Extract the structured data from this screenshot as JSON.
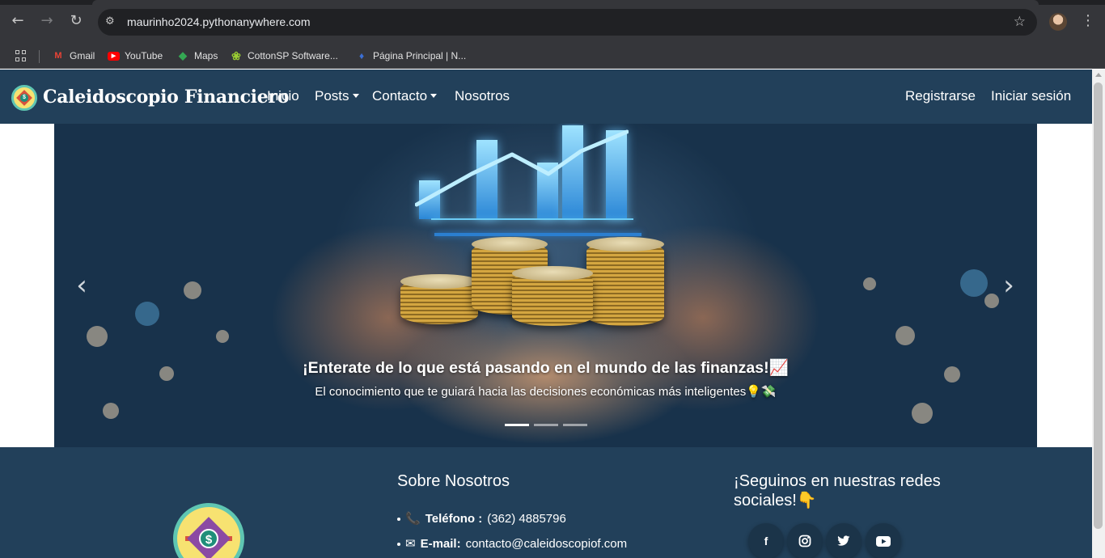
{
  "browser": {
    "url": "maurinho2024.pythonanywhere.com",
    "nav": {
      "back": "←",
      "forward": "→",
      "reload": "↻"
    },
    "bookmarks": [
      {
        "label": "Gmail",
        "icon": "gmail-icon"
      },
      {
        "label": "YouTube",
        "icon": "youtube-icon"
      },
      {
        "label": "Maps",
        "icon": "maps-icon"
      },
      {
        "label": "CottonSP Software...",
        "icon": "cottonsp-icon"
      },
      {
        "label": "Página Principal | N...",
        "icon": "page-icon"
      }
    ]
  },
  "site": {
    "brand": "Caleidoscopio Financiero",
    "nav": {
      "home": "Inicio",
      "posts": "Posts",
      "contact": "Contacto",
      "about": "Nosotros",
      "register": "Registrarse",
      "login": "Iniciar sesión"
    },
    "carousel": {
      "title": "¡Enterate de lo que está pasando en el mundo de las finanzas!📈",
      "text": "El conocimiento que te guiará hacia las decisiones económicas más inteligentes💡💸",
      "prev": "‹",
      "next": "›",
      "slides": 3,
      "active_slide": 1
    },
    "footer": {
      "about_heading": "Sobre Nosotros",
      "phone_label": "Teléfono :",
      "phone_icon": "📞",
      "phone_value": "(362) 4885796",
      "email_label": "E-mail:",
      "email_icon": "✉",
      "email_value": "contacto@caleidoscopiof.com",
      "social_heading": "¡Seguinos en nuestras redes sociales!👇",
      "social_icons": [
        "facebook-icon",
        "instagram-icon",
        "twitter-icon",
        "youtube-icon"
      ]
    }
  },
  "colors": {
    "navbar": "#22405a",
    "chrome": "#35363a",
    "accent_logo": "#5fc6b2"
  }
}
